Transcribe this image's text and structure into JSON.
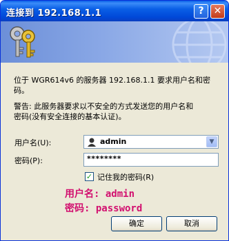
{
  "window": {
    "title": "连接到 192.168.1.1",
    "help_label": "?",
    "close_label": "✕"
  },
  "banner": {
    "icon": "keys-icon",
    "decoration": "globe-icon"
  },
  "message": {
    "line1": "位于 WGR614v6 的服务器 192.168.1.1 要求用户名和密",
    "line2": "码。",
    "warning1": "警告: 此服务器要求以不安全的方式发送您的用户名和",
    "warning2": "密码(没有安全连接的基本认证)。"
  },
  "form": {
    "username_label": "用户名(U):",
    "username_value": "admin",
    "password_label": "密码(P):",
    "password_value": "********",
    "remember_label": "记住我的密码(R)",
    "remember_checked": "✓"
  },
  "annotation": {
    "user_line": "用户名: admin",
    "pass_line": "密码: password",
    "color": "#d2106f"
  },
  "buttons": {
    "ok": "确定",
    "cancel": "取消"
  }
}
